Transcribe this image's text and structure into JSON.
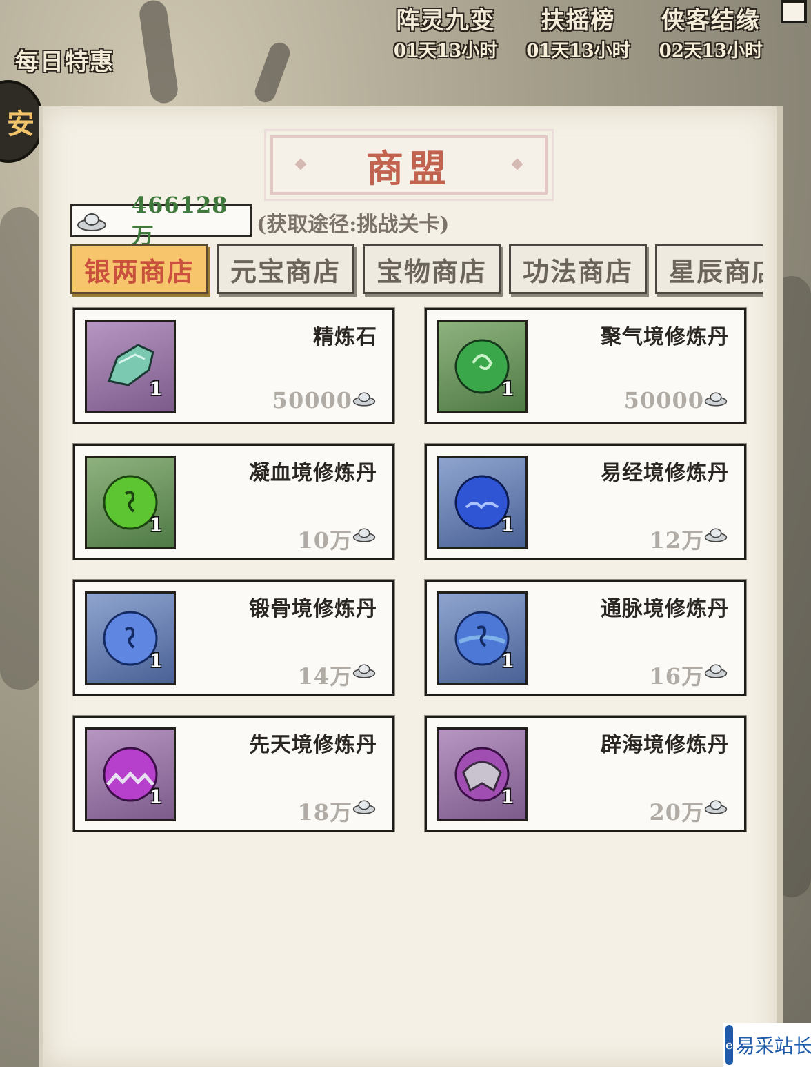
{
  "top_events": [
    {
      "title": "阵灵九变",
      "time": "01天13小时"
    },
    {
      "title": "扶摇榜",
      "time": "01天13小时"
    },
    {
      "title": "侠客结缘",
      "time": "02天13小时"
    }
  ],
  "daily_deal_label": "每日特惠",
  "side_badge_glyph": "安",
  "shop": {
    "title": "商盟",
    "currency": {
      "icon": "silver-ingot-icon",
      "amount": "466128万"
    },
    "acquire_hint": "(获取途径:挑战关卡)",
    "tabs": [
      {
        "label": "银两商店",
        "active": true
      },
      {
        "label": "元宝商店",
        "active": false
      },
      {
        "label": "宝物商店",
        "active": false
      },
      {
        "label": "功法商店",
        "active": false
      },
      {
        "label": "星辰商店",
        "active": false
      }
    ],
    "items": [
      {
        "name": "精炼石",
        "qty": "1",
        "price": "50000",
        "frame": "purple",
        "icon": "refining-stone-icon"
      },
      {
        "name": "聚气境修炼丹",
        "qty": "1",
        "price": "50000",
        "frame": "green",
        "icon": "green-swirl-pill-icon"
      },
      {
        "name": "凝血境修炼丹",
        "qty": "1",
        "price": "10万",
        "frame": "green",
        "icon": "green-rune-pill-icon"
      },
      {
        "name": "易经境修炼丹",
        "qty": "1",
        "price": "12万",
        "frame": "blue",
        "icon": "blue-cloud-pill-icon"
      },
      {
        "name": "锻骨境修炼丹",
        "qty": "1",
        "price": "14万",
        "frame": "blue",
        "icon": "blue-rune-pill-icon"
      },
      {
        "name": "通脉境修炼丹",
        "qty": "1",
        "price": "16万",
        "frame": "blue",
        "icon": "blue-wave-pill-icon"
      },
      {
        "name": "先天境修炼丹",
        "qty": "1",
        "price": "18万",
        "frame": "purple",
        "icon": "purple-crest-pill-icon"
      },
      {
        "name": "辟海境修炼丹",
        "qty": "1",
        "price": "20万",
        "frame": "purple",
        "icon": "purple-shell-pill-icon"
      }
    ]
  },
  "watermark": {
    "text": "易采站长站"
  },
  "colors": {
    "active_tab": "#f7c66c",
    "active_tab_text": "#c9513d",
    "amount": "#3f7a3c",
    "title": "#c2634f"
  }
}
